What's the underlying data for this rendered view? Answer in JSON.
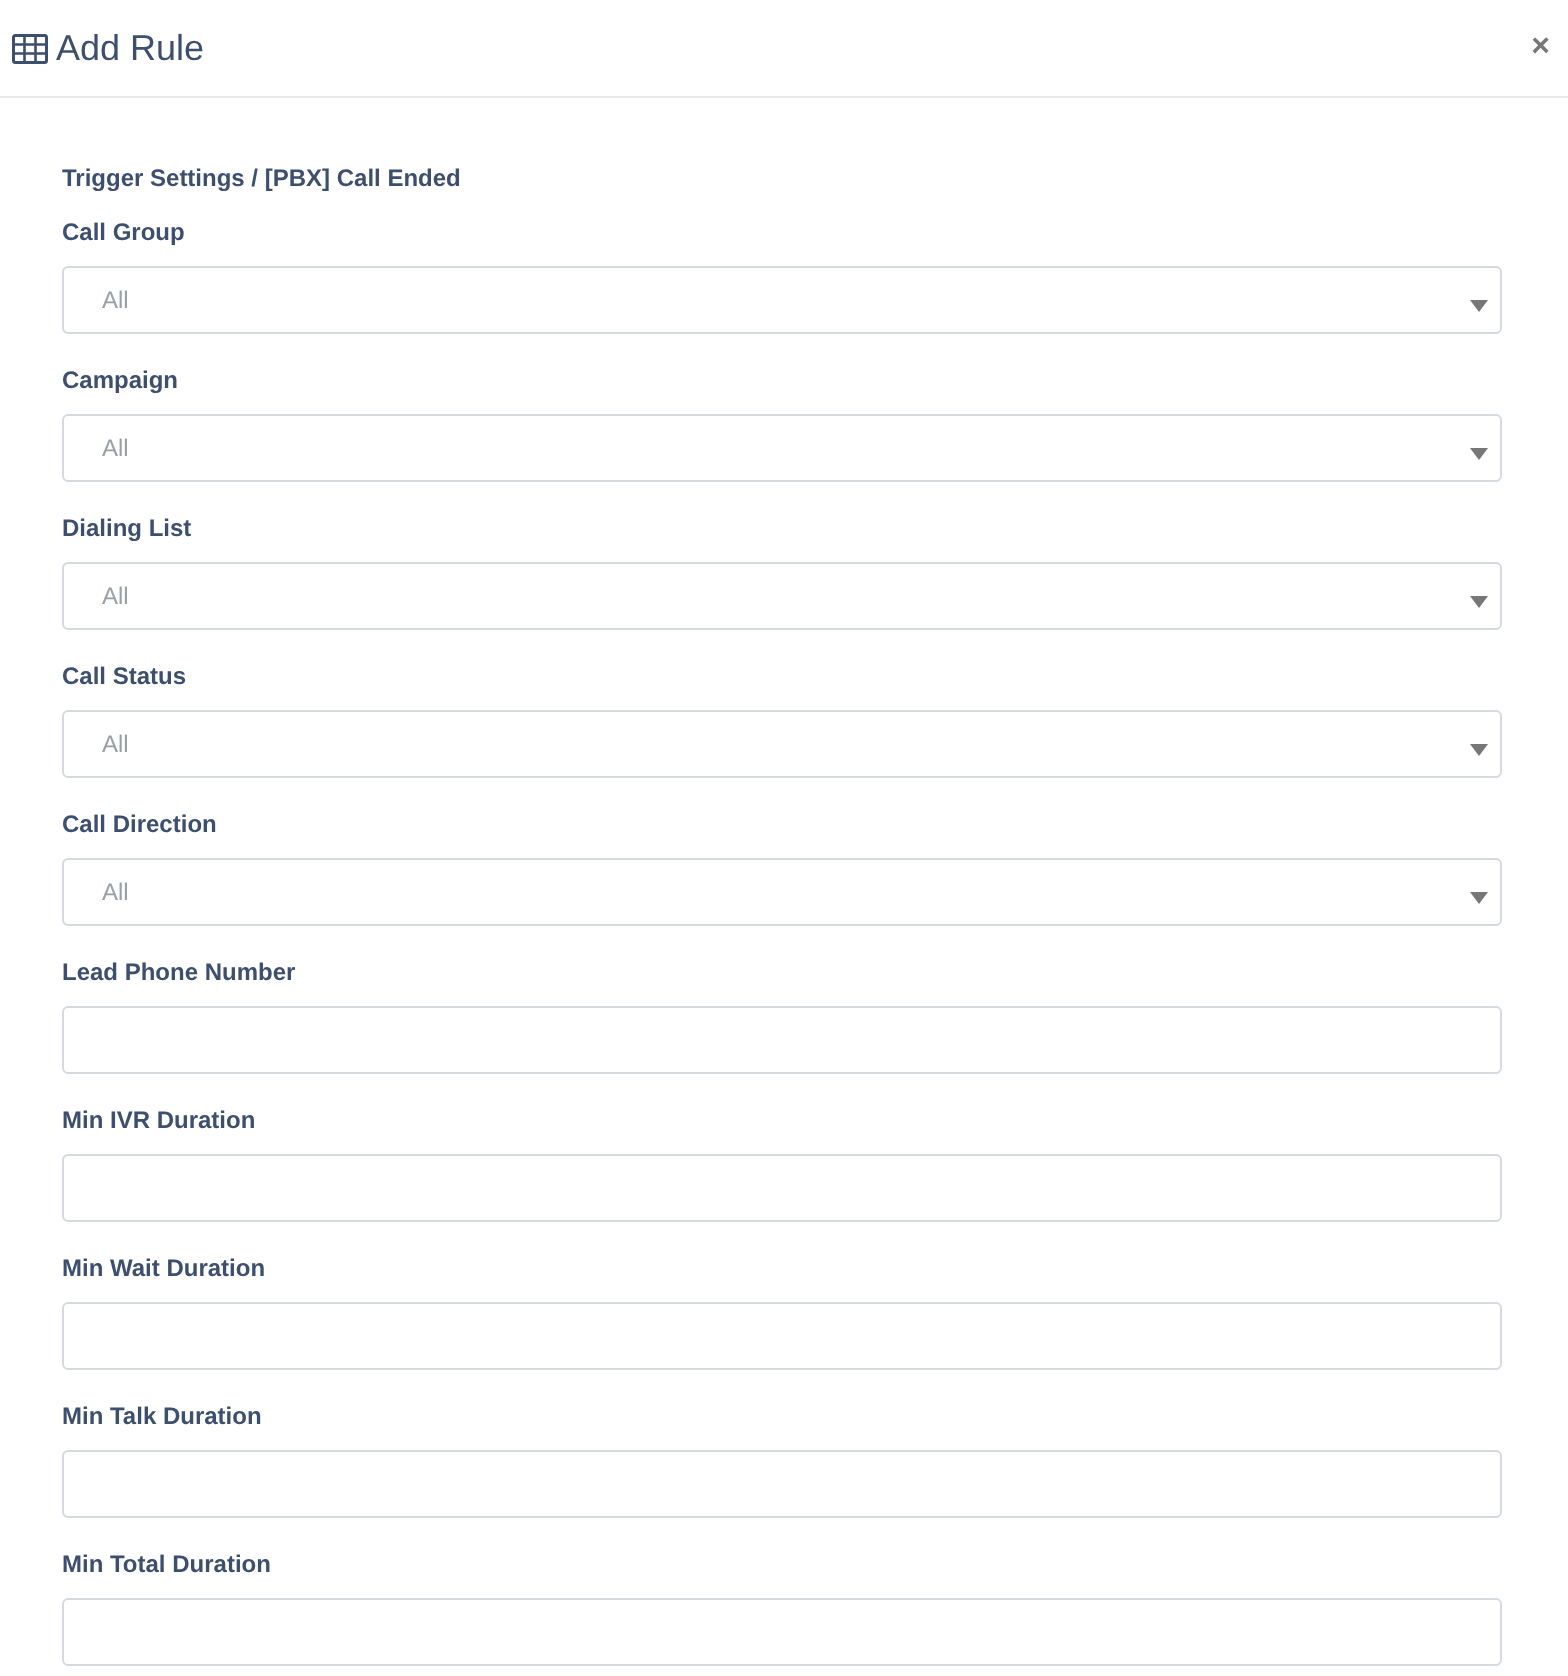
{
  "dialog": {
    "title": "Add Rule",
    "close": "×"
  },
  "breadcrumb": "Trigger Settings / [PBX] Call Ended",
  "fields": [
    {
      "kind": "select",
      "label": "Call Group",
      "value": "All"
    },
    {
      "kind": "select",
      "label": "Campaign",
      "value": "All"
    },
    {
      "kind": "select",
      "label": "Dialing List",
      "value": "All"
    },
    {
      "kind": "select",
      "label": "Call Status",
      "value": "All"
    },
    {
      "kind": "select",
      "label": "Call Direction",
      "value": "All"
    },
    {
      "kind": "input",
      "label": "Lead Phone Number"
    },
    {
      "kind": "input",
      "label": "Min IVR Duration"
    },
    {
      "kind": "input",
      "label": "Min Wait Duration"
    },
    {
      "kind": "input",
      "label": "Min Talk Duration"
    },
    {
      "kind": "input",
      "label": "Min Total Duration"
    }
  ]
}
